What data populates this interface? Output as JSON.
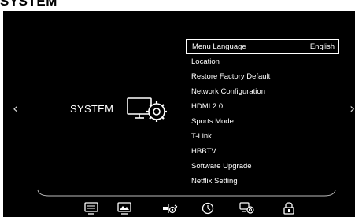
{
  "page_heading": "SYSTEM",
  "nav": {
    "left_arrow": "‹",
    "right_arrow": "›"
  },
  "category": {
    "label": "SYSTEM",
    "icon": "system-settings-icon"
  },
  "menu": {
    "items": [
      {
        "label": "Menu Language",
        "value": "English",
        "selected": true
      },
      {
        "label": "Location"
      },
      {
        "label": "Restore Factory Default"
      },
      {
        "label": "Network Configuration"
      },
      {
        "label": "HDMI 2.0"
      },
      {
        "label": "Sports Mode"
      },
      {
        "label": "T-Link"
      },
      {
        "label": "HBBTV"
      },
      {
        "label": "Software Upgrade"
      },
      {
        "label": "Netflix Setting"
      }
    ]
  },
  "bottom_bar": {
    "icons": [
      "picture-icon",
      "screen-icon",
      "sound-icon",
      "timer-icon",
      "system-icon",
      "lock-icon"
    ],
    "active": "system-icon"
  },
  "colors": {
    "background": "#000000",
    "text": "#ffffff",
    "arrow": "#cfcfcf"
  }
}
